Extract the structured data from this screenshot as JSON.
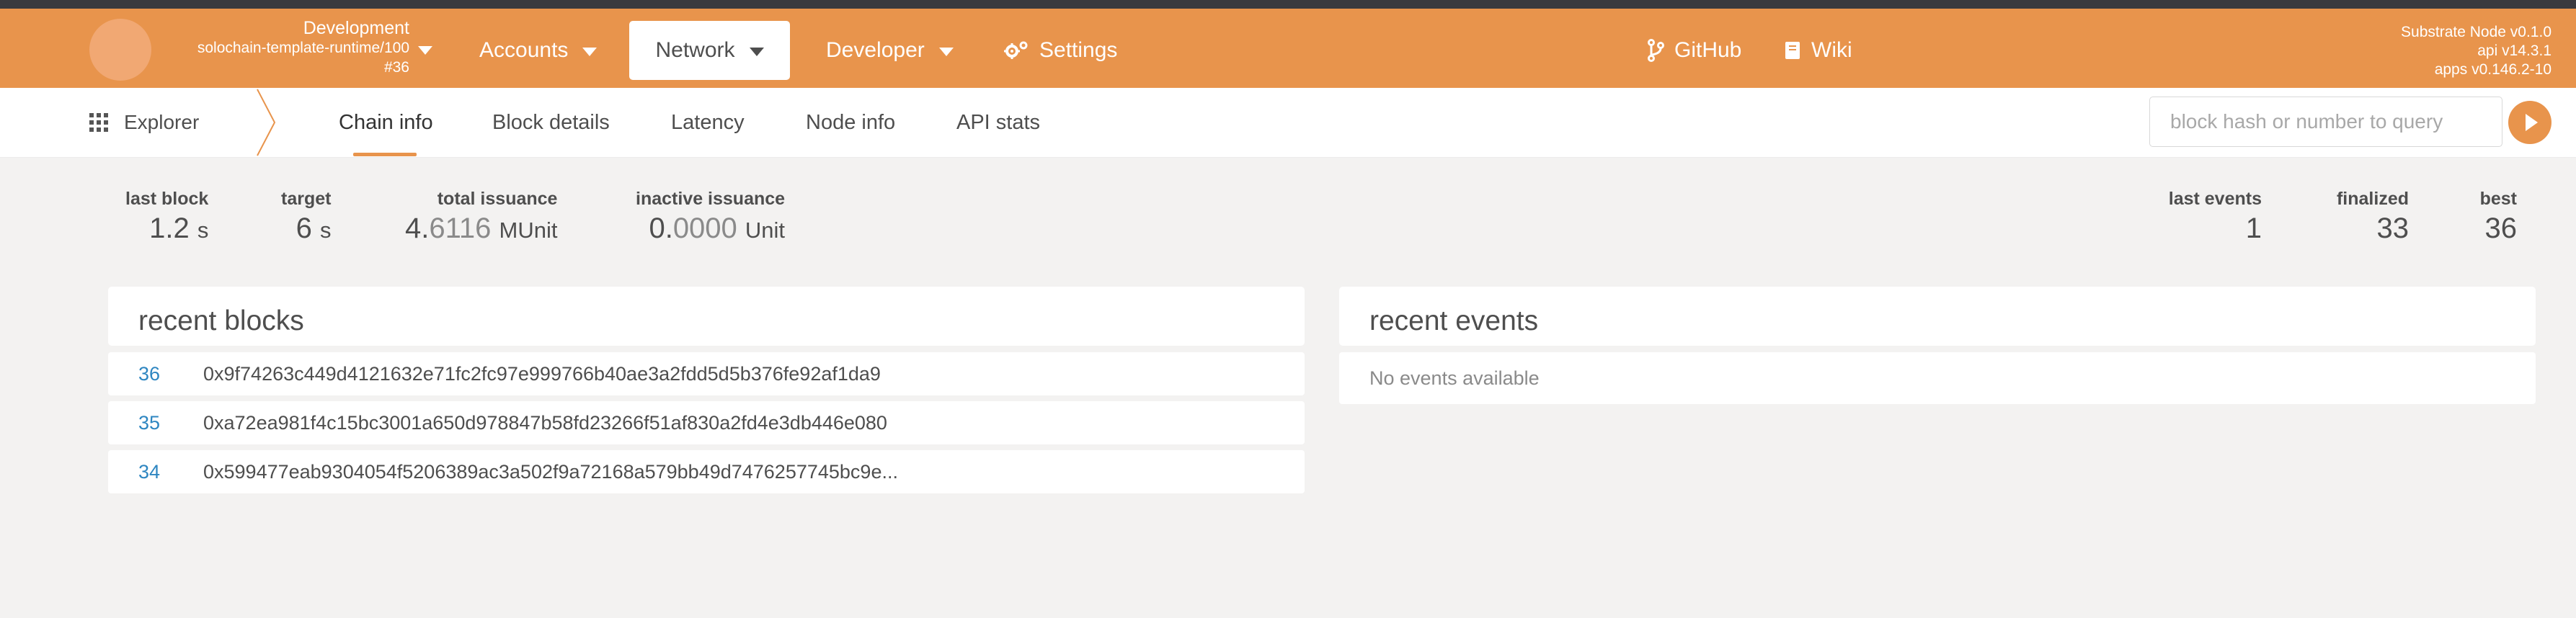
{
  "header": {
    "chain": {
      "name": "Development",
      "runtime": "solochain-template-runtime/100",
      "block": "#36"
    },
    "menu": [
      {
        "label": "Accounts"
      },
      {
        "label": "Network"
      },
      {
        "label": "Developer"
      },
      {
        "label": "Settings"
      }
    ],
    "links": [
      {
        "label": "GitHub"
      },
      {
        "label": "Wiki"
      }
    ],
    "version": {
      "node": "Substrate Node v0.1.0",
      "api": "api v14.3.1",
      "apps": "apps v0.146.2-10"
    }
  },
  "subnav": {
    "section": "Explorer",
    "tabs": [
      {
        "label": "Chain info"
      },
      {
        "label": "Block details"
      },
      {
        "label": "Latency"
      },
      {
        "label": "Node info"
      },
      {
        "label": "API stats"
      }
    ],
    "active_tab": "Chain info",
    "search_placeholder": "block hash or number to query"
  },
  "stats": {
    "last_block": {
      "label": "last block",
      "value": "1.2",
      "unit": "s"
    },
    "target": {
      "label": "target",
      "value": "6",
      "unit": "s"
    },
    "total_issuance": {
      "label": "total issuance",
      "value_int": "4.",
      "value_frac": "6116",
      "unit": "MUnit"
    },
    "inactive_issuance": {
      "label": "inactive issuance",
      "value_int": "0.",
      "value_frac": "0000",
      "unit": "Unit"
    },
    "last_events": {
      "label": "last events",
      "value": "1"
    },
    "finalized": {
      "label": "finalized",
      "value": "33"
    },
    "best": {
      "label": "best",
      "value": "36"
    }
  },
  "recent_blocks": {
    "title": "recent blocks",
    "rows": [
      {
        "number": "36",
        "hash": "0x9f74263c449d4121632e71fc2fc97e999766b40ae3a2fdd5d5b376fe92af1da9"
      },
      {
        "number": "35",
        "hash": "0xa72ea981f4c15bc3001a650d978847b58fd23266f51af830a2fd4e3db446e080"
      },
      {
        "number": "34",
        "hash": "0x599477eab9304054f5206389ac3a502f9a72168a579bb49d7476257745bc9e..."
      }
    ]
  },
  "recent_events": {
    "title": "recent events",
    "empty": "No events available"
  },
  "colors": {
    "accent": "#e8944c",
    "link": "#2e86c1",
    "background": "#f3f2f1"
  }
}
